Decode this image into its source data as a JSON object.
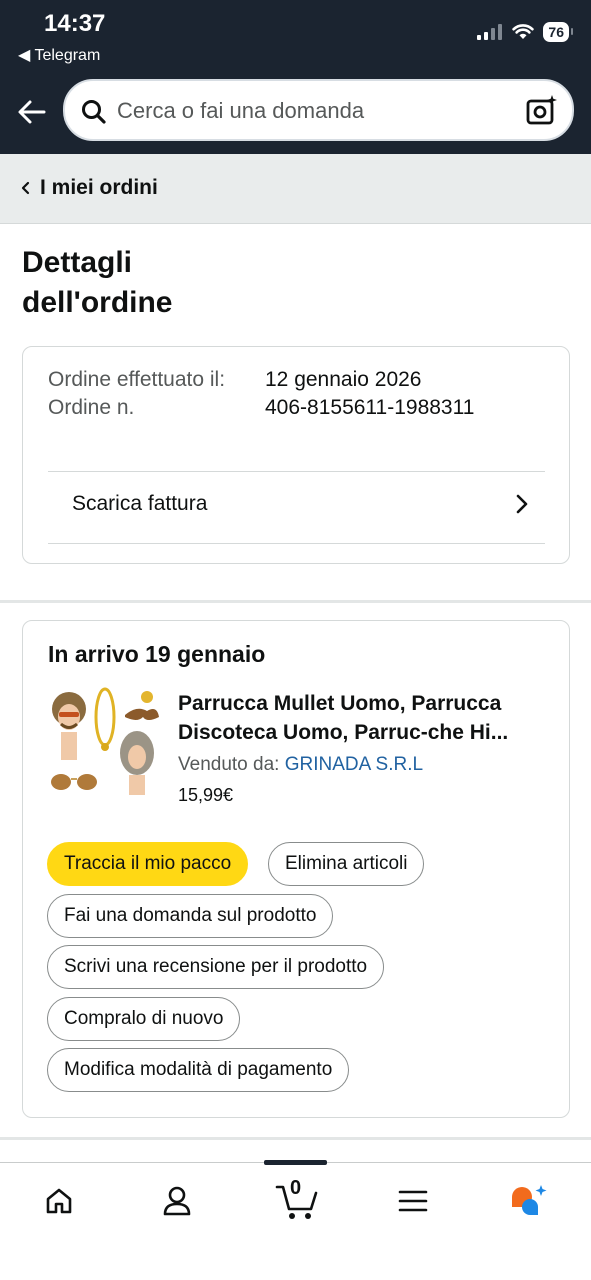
{
  "status_bar": {
    "time": "14:37",
    "back_app": "◀ Telegram",
    "battery": "76"
  },
  "search": {
    "placeholder": "Cerca o fai una domanda"
  },
  "breadcrumb": {
    "label": "I miei ordini"
  },
  "page": {
    "title": "Dettagli dell'ordine"
  },
  "order_info": {
    "date_label": "Ordine effettuato il:",
    "date_value": "12 gennaio 2026",
    "number_label": "Ordine n.",
    "number_value": "406-8155611-1988311",
    "invoice_label": "Scarica fattura"
  },
  "shipment": {
    "arrival": "In arrivo 19 gennaio",
    "product_title_line1": "Parrucca Mullet Uomo, Parrucca",
    "product_title_line2": "Discoteca Uomo, Parruc-che Hi...",
    "seller_prefix": "Venduto da: ",
    "seller_name": "GRINADA S.R.L",
    "price": "15,99€",
    "buttons": {
      "track": "Traccia il mio pacco",
      "delete": "Elimina articoli",
      "ask": "Fai una domanda sul prodotto",
      "review": "Scrivi una recensione per il prodotto",
      "buy_again": "Compralo di nuovo",
      "payment": "Modifica modalità di pagamento"
    }
  },
  "bottom_nav": {
    "cart_count": "0"
  },
  "colors": {
    "header_bg": "#1b2430",
    "primary_button": "#ffd814",
    "link": "#2162a1"
  }
}
